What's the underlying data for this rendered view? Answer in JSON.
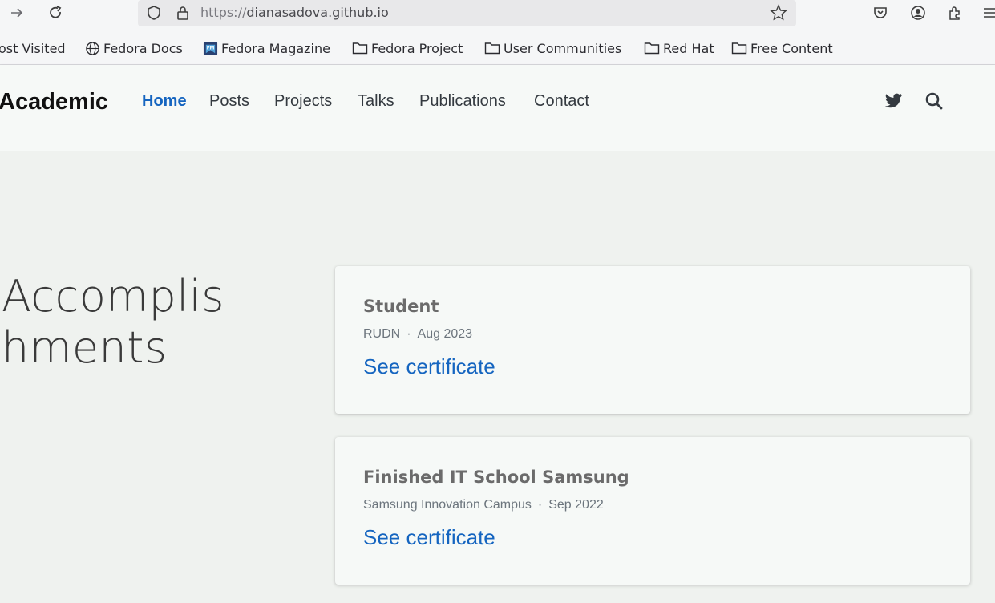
{
  "browser": {
    "url_protocol": "https://",
    "url_host": "dianasadova.github.io",
    "bookmarks": [
      {
        "label": "ost Visited",
        "icon": "none"
      },
      {
        "label": "Fedora Docs",
        "icon": "globe-icon"
      },
      {
        "label": "Fedora Magazine",
        "icon": "fedora-magazine-icon"
      },
      {
        "label": "Fedora Project",
        "icon": "folder-icon"
      },
      {
        "label": "User Communities",
        "icon": "folder-icon"
      },
      {
        "label": "Red Hat",
        "icon": "folder-icon"
      },
      {
        "label": "Free Content",
        "icon": "folder-icon"
      }
    ]
  },
  "site": {
    "brand": "Academic",
    "nav": [
      {
        "label": "Home",
        "active": true
      },
      {
        "label": "Posts",
        "active": false
      },
      {
        "label": "Projects",
        "active": false
      },
      {
        "label": "Talks",
        "active": false
      },
      {
        "label": "Publications",
        "active": false
      },
      {
        "label": "Contact",
        "active": false
      }
    ]
  },
  "section": {
    "title_line1": "Accomplis",
    "title_line2": "hments"
  },
  "accomplishments": [
    {
      "title": "Student",
      "organization": "RUDN",
      "separator": "·",
      "date": "Aug 2023",
      "link": "See certificate"
    },
    {
      "title": "Finished IT School Samsung",
      "organization": "Samsung Innovation Campus",
      "separator": "·",
      "date": "Sep 2022",
      "link": "See certificate"
    }
  ],
  "colors": {
    "accent": "#1565c0",
    "page_bg": "#eff2ef",
    "card_bg": "#f6f9f7"
  }
}
